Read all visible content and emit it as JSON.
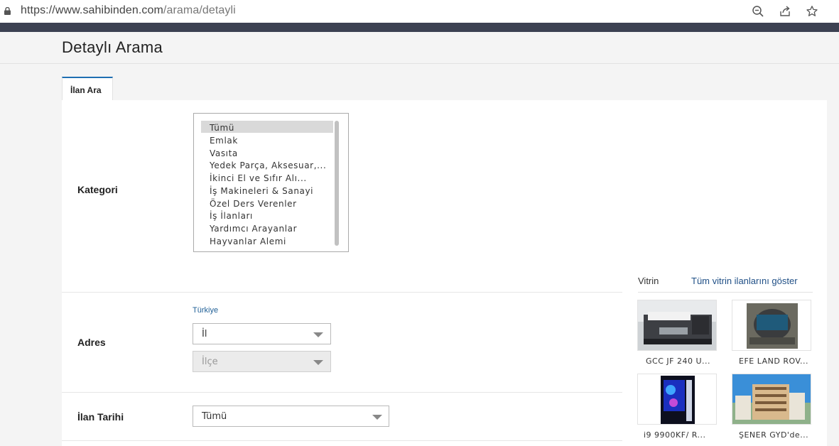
{
  "browser": {
    "url_host": "https://www.sahibinden.com",
    "url_path": "/arama/detayli",
    "icons": [
      "lock-icon",
      "zoom-out-icon",
      "share-icon",
      "bookmark-star-icon"
    ]
  },
  "page": {
    "title": "Detaylı Arama",
    "tab_label": "İlan Ara"
  },
  "kategori": {
    "label": "Kategori",
    "options": [
      "Tümü",
      "Emlak",
      "Vasıta",
      "Yedek Parça, Aksesuar,...",
      "İkinci El ve Sıfır Alı...",
      "İş Makineleri & Sanayi",
      "Özel Ders Verenler",
      "İş İlanları",
      "Yardımcı Arayanlar",
      "Hayvanlar Alemi"
    ],
    "selected": "Tümü"
  },
  "adres": {
    "label": "Adres",
    "country_link": "Türkiye",
    "il_value": "İl",
    "ilce_value": "İlçe"
  },
  "ilan_tarihi": {
    "label": "İlan Tarihi",
    "value": "Tümü"
  },
  "vitrin": {
    "title": "Vitrin",
    "show_all": "Tüm vitrin ilanlarını göster",
    "items": [
      {
        "caption": "GCC JF 240 U...",
        "image": "uv-printer-image"
      },
      {
        "caption": "EFE LAND ROV...",
        "image": "engine-image"
      },
      {
        "caption": "i9 9900KF/ R...",
        "image": "gaming-pc-image"
      },
      {
        "caption": "ŞENER GYD'de...",
        "image": "apartment-building-image"
      }
    ]
  },
  "colors": {
    "accent_tab": "#1f6fb2",
    "link": "#1f4f86",
    "dark_bar": "#3c4152"
  }
}
